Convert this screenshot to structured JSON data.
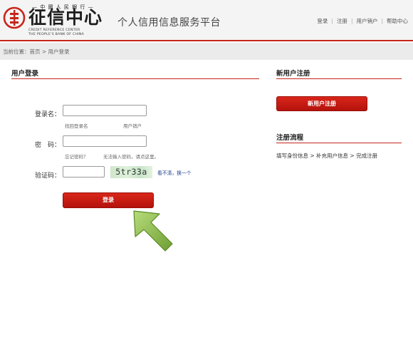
{
  "header": {
    "logo_top": "— 中 國 人 民 銀 行 —",
    "logo_main": "征信中心",
    "logo_en_line1": "CREDIT REFERENCE CENTER",
    "logo_en_line2": "THE PEOPLE'S BANK OF CHINA",
    "site_title": "个人信用信息服务平台",
    "nav": [
      "登录",
      "注册",
      "用户销户",
      "帮助中心"
    ]
  },
  "breadcrumb": "当前位置：首页 > 用户登录",
  "login": {
    "section_title": "用户登录",
    "username_label": "登录名：",
    "username_value": "",
    "forgot_username": "找回登录名",
    "cancel_account": "用户销户",
    "password_label": "密　码：",
    "password_value": "",
    "forgot_password": "忘记密码？",
    "password_hint": "无法输入密码，请点这里。",
    "captcha_label": "验证码：",
    "captcha_value": "",
    "captcha_text": "5tr33a",
    "captcha_refresh": "看不清，换一个",
    "submit_label": "登录"
  },
  "register": {
    "section_title": "新用户注册",
    "button_label": "新用户注册"
  },
  "process": {
    "section_title": "注册流程",
    "steps": "填写身份信息 > 补充用户信息 > 完成注册"
  },
  "colors": {
    "brand_red": "#c6251c",
    "arrow_green": "#8dc04a"
  }
}
